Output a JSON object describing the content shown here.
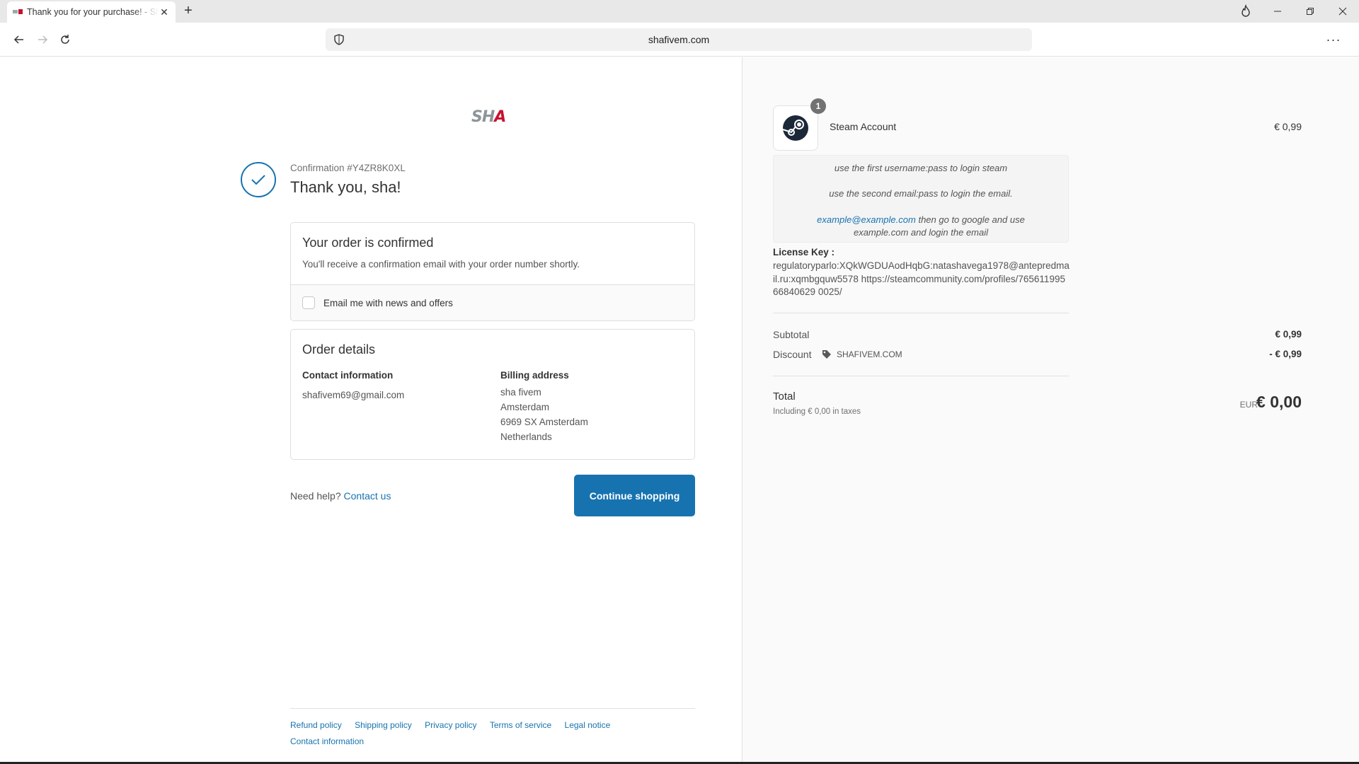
{
  "browser": {
    "tab_title": "Thank you for your purchase! - Sha",
    "url": "shafivem.com"
  },
  "logo": {
    "text_part1": "SH",
    "text_part2": "A"
  },
  "confirmation": {
    "number": "Confirmation #Y4ZR8K0XL",
    "thanks": "Thank you, sha!"
  },
  "order_confirmed": {
    "heading": "Your order is confirmed",
    "subtext": "You'll receive a confirmation email with your order number shortly.",
    "newsletter_label": "Email me with news and offers",
    "newsletter_checked": false
  },
  "order_details": {
    "heading": "Order details",
    "contact_heading": "Contact information",
    "contact_email": "shafivem69@gmail.com",
    "billing_heading": "Billing address",
    "billing_lines": [
      "sha fivem",
      "Amsterdam",
      "6969 SX Amsterdam",
      "Netherlands"
    ]
  },
  "help": {
    "text": "Need help?",
    "link": "Contact us"
  },
  "continue_button": "Continue shopping",
  "footer": {
    "links": [
      "Refund policy",
      "Shipping policy",
      "Privacy policy",
      "Terms of service",
      "Legal notice",
      "Contact information"
    ]
  },
  "summary": {
    "product": {
      "quantity": "1",
      "name": "Steam Account",
      "price": "€ 0,99",
      "thumb_icon": "steam-icon"
    },
    "notes": {
      "line1": "use the first username:pass to login steam",
      "line2": "use the second email:pass to login the email.",
      "line3_link": "example@example.com",
      "line3_text": "then go to google and use",
      "line4": "example.com and login the email"
    },
    "license_label": "License Key :",
    "license_value": "regulatoryparlo:XQkWGDUAodHqbG:natashavega1978@antepredmail.ru:xqmbgquw5578 https://steamcommunity.com/profiles/76561199566840629 0025/",
    "subtotal_label": "Subtotal",
    "subtotal_value": "€ 0,99",
    "discount_label": "Discount",
    "discount_code": "SHAFIVEM.COM",
    "discount_value": "- € 0,99",
    "total_label": "Total",
    "total_tax": "Including € 0,00 in taxes",
    "total_currency": "EUR",
    "total_value": "€ 0,00"
  },
  "colors": {
    "accent": "#1773b0",
    "logo_red": "#c8102e"
  }
}
